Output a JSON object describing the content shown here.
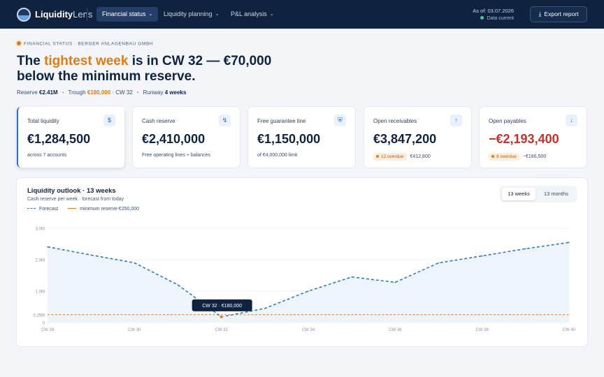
{
  "app": {
    "brand_bold": "Liquidity",
    "brand_light": "Lens"
  },
  "nav": [
    {
      "label": "Financial status",
      "active": true
    },
    {
      "label": "Liquidity planning",
      "active": false
    },
    {
      "label": "P&L analysis",
      "active": false
    }
  ],
  "status": {
    "as_of": "As of: 03.07.2026",
    "data_state": "Data current"
  },
  "toolbar": {
    "export_label": "Export report"
  },
  "header": {
    "eyebrow": "FINANCIAL STATUS · BERGER ANLAGENBAU GMBH",
    "headline_pre": "The ",
    "headline_hl": "tightest week",
    "headline_post": " is in CW 32 — €70,000 below the minimum reserve.",
    "reserve_label": "Reserve",
    "reserve_value": "€2.41M",
    "trough_label": "Trough",
    "trough_value": "€180,000",
    "trough_week": "· CW 32",
    "runway_label": "Runway",
    "runway_value": "4 weeks"
  },
  "cards": [
    {
      "label": "Total liquidity",
      "icon": "dollar-icon",
      "value": "€1,284,500",
      "sub": "across 7 accounts"
    },
    {
      "label": "Cash reserve",
      "icon": "bolt-icon",
      "value": "€2,410,000",
      "sub": "Free operating lines + balances"
    },
    {
      "label": "Free guarantee line",
      "icon": "shield-icon",
      "value": "€1,150,000",
      "sub": "of €4,000,000 limit"
    },
    {
      "label": "Open receivables",
      "icon": "arrow-up-icon",
      "value": "€3,847,200",
      "badge": "12 overdue",
      "sub": "€412,800"
    },
    {
      "label": "Open payables",
      "icon": "arrow-down-icon",
      "value": "−€2,193,400",
      "badge": "8 overdue",
      "sub": "−€186,500"
    }
  ],
  "chart_panel": {
    "title": "Liquidity outlook · 13 weeks",
    "subtitle": "Cash reserve per week · forecast from today",
    "legend_forecast": "Forecast",
    "legend_min": "minimum reserve €250,000",
    "toggle": [
      {
        "label": "13 weeks",
        "active": true
      },
      {
        "label": "13 months",
        "active": false
      }
    ]
  },
  "chart_data": {
    "type": "line",
    "x": [
      "CW 28",
      "CW 29",
      "CW 30",
      "CW 31",
      "CW 32",
      "CW 33",
      "CW 34",
      "CW 35",
      "CW 36",
      "CW 37",
      "CW 38",
      "CW 39",
      "CW 40"
    ],
    "x_tick_labels": [
      "CW 28",
      "CW 30",
      "CW 32",
      "CW 34",
      "CW 36",
      "CW 38",
      "CW 40"
    ],
    "y_tick_values": [
      0,
      0.25,
      1.0,
      2.0,
      3.0
    ],
    "y_tick_labels": [
      "0",
      "0.25M",
      "1.0M",
      "2.0M",
      "3.0M"
    ],
    "series": [
      {
        "name": "Forecast",
        "values": [
          2.41,
          2.15,
          1.9,
          1.2,
          0.18,
          0.45,
          1.0,
          1.45,
          1.28,
          1.9,
          2.12,
          2.35,
          2.55
        ],
        "color": "#2f7cc4"
      }
    ],
    "reference_line": {
      "name": "minimum reserve €250,000",
      "value": 0.25,
      "color": "#e07b16"
    },
    "ylim": [
      0,
      3.0
    ],
    "tooltip": {
      "label": "CW 32 · €180,000",
      "index": 4
    },
    "grid": true
  }
}
